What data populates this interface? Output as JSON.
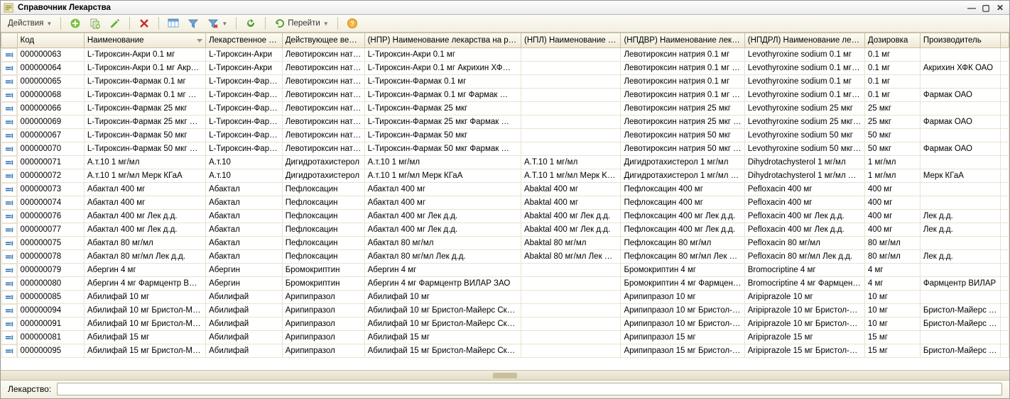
{
  "window": {
    "title": "Справочник Лекарства"
  },
  "toolbar": {
    "actions_label": "Действия",
    "go_label": "Перейти"
  },
  "bottom": {
    "label": "Лекарство:",
    "value": ""
  },
  "columns": {
    "marker": "",
    "code": "Код",
    "name": "Наименование",
    "leksred": "Лекарственное с…",
    "deistv": "Действующее веще…",
    "npr": "(НПР) Наименование лекарства на рус…",
    "npl": "(НПЛ) Наименование ле…",
    "npldvr": "(НПДВР) Наименование лекар…",
    "npdrl": "(НПДРЛ) Наименование лека…",
    "doz": "Дозировка",
    "proizv": "Производитель",
    "tail": ""
  },
  "rows": [
    {
      "code": "000000063",
      "name": "L-Тироксин-Акри  0.1 мг",
      "leksred": "L-Тироксин-Акри",
      "deistv": "Левотироксин натр…",
      "npr": "L-Тироксин-Акри  0.1 мг",
      "npl": "",
      "npldvr": "Левотироксин натрия  0.1 мг",
      "npdrl": "Levothyroxine sodium  0.1 мг",
      "doz": "0.1 мг",
      "proizv": ""
    },
    {
      "code": "000000064",
      "name": "L-Тироксин-Акри  0.1 мг  Акр…",
      "leksred": "L-Тироксин-Акри",
      "deistv": "Левотироксин натр…",
      "npr": "L-Тироксин-Акри  0.1 мг  Акрихин ХФ…",
      "npl": "",
      "npldvr": "Левотироксин натрия  0.1 мг …",
      "npdrl": "Levothyroxine sodium  0.1 мг …",
      "doz": "0.1 мг",
      "proizv": "Акрихин ХФК ОАО"
    },
    {
      "code": "000000065",
      "name": "L-Тироксин-Фармак  0.1 мг",
      "leksred": "L-Тироксин-Фар…",
      "deistv": "Левотироксин натр…",
      "npr": "L-Тироксин-Фармак  0.1 мг",
      "npl": "",
      "npldvr": "Левотироксин натрия  0.1 мг",
      "npdrl": "Levothyroxine sodium  0.1 мг",
      "doz": "0.1 мг",
      "proizv": ""
    },
    {
      "code": "000000068",
      "name": "L-Тироксин-Фармак  0.1 мг  …",
      "leksred": "L-Тироксин-Фар…",
      "deistv": "Левотироксин натр…",
      "npr": "L-Тироксин-Фармак  0.1 мг  Фармак …",
      "npl": "",
      "npldvr": "Левотироксин натрия  0.1 мг …",
      "npdrl": "Levothyroxine sodium  0.1 мг …",
      "doz": "0.1 мг",
      "proizv": "Фармак ОАО"
    },
    {
      "code": "000000066",
      "name": "L-Тироксин-Фармак  25 мкг",
      "leksred": "L-Тироксин-Фар…",
      "deistv": "Левотироксин натр…",
      "npr": "L-Тироксин-Фармак  25 мкг",
      "npl": "",
      "npldvr": "Левотироксин натрия  25 мкг",
      "npdrl": "Levothyroxine sodium  25 мкг",
      "doz": "25 мкг",
      "proizv": ""
    },
    {
      "code": "000000069",
      "name": "L-Тироксин-Фармак  25 мкг  …",
      "leksred": "L-Тироксин-Фар…",
      "deistv": "Левотироксин натр…",
      "npr": "L-Тироксин-Фармак  25 мкг  Фармак …",
      "npl": "",
      "npldvr": "Левотироксин натрия  25 мкг …",
      "npdrl": "Levothyroxine sodium  25 мкг …",
      "doz": "25 мкг",
      "proizv": "Фармак ОАО"
    },
    {
      "code": "000000067",
      "name": "L-Тироксин-Фармак  50 мкг",
      "leksred": "L-Тироксин-Фар…",
      "deistv": "Левотироксин натр…",
      "npr": "L-Тироксин-Фармак  50 мкг",
      "npl": "",
      "npldvr": "Левотироксин натрия  50 мкг",
      "npdrl": "Levothyroxine sodium  50 мкг",
      "doz": "50 мкг",
      "proizv": ""
    },
    {
      "code": "000000070",
      "name": "L-Тироксин-Фармак  50 мкг  …",
      "leksred": "L-Тироксин-Фар…",
      "deistv": "Левотироксин натр…",
      "npr": "L-Тироксин-Фармак  50 мкг  Фармак …",
      "npl": "",
      "npldvr": "Левотироксин натрия  50 мкг …",
      "npdrl": "Levothyroxine sodium  50 мкг …",
      "doz": "50 мкг",
      "proizv": "Фармак ОАО"
    },
    {
      "code": "000000071",
      "name": "А.т.10  1 мг/мл",
      "leksred": "А.т.10",
      "deistv": "Дигидротахистерол",
      "npr": "А.т.10  1 мг/мл",
      "npl": "A.T.10  1 мг/мл",
      "npldvr": "Дигидротахистерол  1 мг/мл",
      "npdrl": "Dihydrotachysterol  1 мг/мл",
      "doz": "1 мг/мл",
      "proizv": ""
    },
    {
      "code": "000000072",
      "name": "А.т.10  1 мг/мл  Мерк КГаА",
      "leksred": "А.т.10",
      "deistv": "Дигидротахистерол",
      "npr": "А.т.10  1 мг/мл  Мерк КГаА",
      "npl": "A.T.10  1 мг/мл  Мерк K…",
      "npldvr": "Дигидротахистерол  1 мг/мл …",
      "npdrl": "Dihydrotachysterol  1 мг/мл  M…",
      "doz": "1 мг/мл",
      "proizv": "Мерк КГаА"
    },
    {
      "code": "000000073",
      "name": "Абактал  400 мг",
      "leksred": "Абактал",
      "deistv": "Пефлоксацин",
      "npr": "Абактал  400 мг",
      "npl": "Abaktal  400 мг",
      "npldvr": "Пефлоксацин  400 мг",
      "npdrl": "Pefloxacin  400 мг",
      "doz": "400 мг",
      "proizv": ""
    },
    {
      "code": "000000074",
      "name": "Абактал  400 мг",
      "leksred": "Абактал",
      "deistv": "Пефлоксацин",
      "npr": "Абактал  400 мг",
      "npl": "Abaktal  400 мг",
      "npldvr": "Пефлоксацин  400 мг",
      "npdrl": "Pefloxacin  400 мг",
      "doz": "400 мг",
      "proizv": ""
    },
    {
      "code": "000000076",
      "name": "Абактал  400 мг  Лек д.д.",
      "leksred": "Абактал",
      "deistv": "Пефлоксацин",
      "npr": "Абактал  400 мг  Лек д.д.",
      "npl": "Abaktal  400 мг  Лек д.д.",
      "npldvr": "Пефлоксацин  400 мг  Лек д.д.",
      "npdrl": "Pefloxacin  400 мг  Лек д.д.",
      "doz": "400 мг",
      "proizv": "Лек д.д."
    },
    {
      "code": "000000077",
      "name": "Абактал  400 мг  Лек д.д.",
      "leksred": "Абактал",
      "deistv": "Пефлоксацин",
      "npr": "Абактал  400 мг  Лек д.д.",
      "npl": "Abaktal  400 мг  Лек д.д.",
      "npldvr": "Пефлоксацин  400 мг  Лек д.д.",
      "npdrl": "Pefloxacin  400 мг  Лек д.д.",
      "doz": "400 мг",
      "proizv": "Лек д.д."
    },
    {
      "code": "000000075",
      "name": "Абактал  80 мг/мл",
      "leksred": "Абактал",
      "deistv": "Пефлоксацин",
      "npr": "Абактал  80 мг/мл",
      "npl": "Abaktal  80 мг/мл",
      "npldvr": "Пефлоксацин  80 мг/мл",
      "npdrl": "Pefloxacin  80 мг/мл",
      "doz": "80 мг/мл",
      "proizv": ""
    },
    {
      "code": "000000078",
      "name": "Абактал  80 мг/мл  Лек д.д.",
      "leksred": "Абактал",
      "deistv": "Пефлоксацин",
      "npr": "Абактал  80 мг/мл  Лек д.д.",
      "npl": "Abaktal  80 мг/мл  Лек …",
      "npldvr": "Пефлоксацин  80 мг/мл  Лек д.д.",
      "npdrl": "Pefloxacin  80 мг/мл  Лек д.д.",
      "doz": "80 мг/мл",
      "proizv": "Лек д.д."
    },
    {
      "code": "000000079",
      "name": "Абергин  4 мг",
      "leksred": "Абергин",
      "deistv": "Бромокриптин",
      "npr": "Абергин  4 мг",
      "npl": "",
      "npldvr": "Бромокриптин  4 мг",
      "npdrl": "Bromocriptine  4 мг",
      "doz": "4 мг",
      "proizv": ""
    },
    {
      "code": "000000080",
      "name": "Абергин  4 мг  Фармцентр В…",
      "leksred": "Абергин",
      "deistv": "Бромокриптин",
      "npr": "Абергин  4 мг  Фармцентр ВИЛАР ЗАО",
      "npl": "",
      "npldvr": "Бромокриптин  4 мг  Фармцен…",
      "npdrl": "Bromocriptine  4 мг  Фармцен…",
      "doz": "4 мг",
      "proizv": "Фармцентр ВИЛАР"
    },
    {
      "code": "000000085",
      "name": "Абилифай  10 мг",
      "leksred": "Абилифай",
      "deistv": "Арипипразол",
      "npr": "Абилифай  10 мг",
      "npl": "",
      "npldvr": "Арипипразол  10 мг",
      "npdrl": "Aripiprazole  10 мг",
      "doz": "10 мг",
      "proizv": ""
    },
    {
      "code": "000000094",
      "name": "Абилифай  10 мг  Бристол-Ма…",
      "leksred": "Абилифай",
      "deistv": "Арипипразол",
      "npr": "Абилифай  10 мг  Бристол-Майерс Скв…",
      "npl": "",
      "npldvr": "Арипипразол  10 мг  Бристол-…",
      "npdrl": "Aripiprazole  10 мг  Бристол-М…",
      "doz": "10 мг",
      "proizv": "Бристол-Майерс Ск"
    },
    {
      "code": "000000091",
      "name": "Абилифай  10 мг  Бристол-Ма…",
      "leksred": "Абилифай",
      "deistv": "Арипипразол",
      "npr": "Абилифай  10 мг  Бристол-Майерс Скв…",
      "npl": "",
      "npldvr": "Арипипразол  10 мг  Бристол-…",
      "npdrl": "Aripiprazole  10 мг  Бристол-М…",
      "doz": "10 мг",
      "proizv": "Бристол-Майерс Ск"
    },
    {
      "code": "000000081",
      "name": "Абилифай  15 мг",
      "leksred": "Абилифай",
      "deistv": "Арипипразол",
      "npr": "Абилифай  15 мг",
      "npl": "",
      "npldvr": "Арипипразол  15 мг",
      "npdrl": "Aripiprazole  15 мг",
      "doz": "15 мг",
      "proizv": ""
    },
    {
      "code": "000000095",
      "name": "Абилифай  15 мг  Бристол-Ма…",
      "leksred": "Абилифай",
      "deistv": "Арипипразол",
      "npr": "Абилифай  15 мг  Бристол-Майерс Скв…",
      "npl": "",
      "npldvr": "Арипипразол  15 мг  Бристол-…",
      "npdrl": "Aripiprazole  15 мг  Бристол-М…",
      "doz": "15 мг",
      "proizv": "Бристол-Майерс Ск"
    }
  ]
}
